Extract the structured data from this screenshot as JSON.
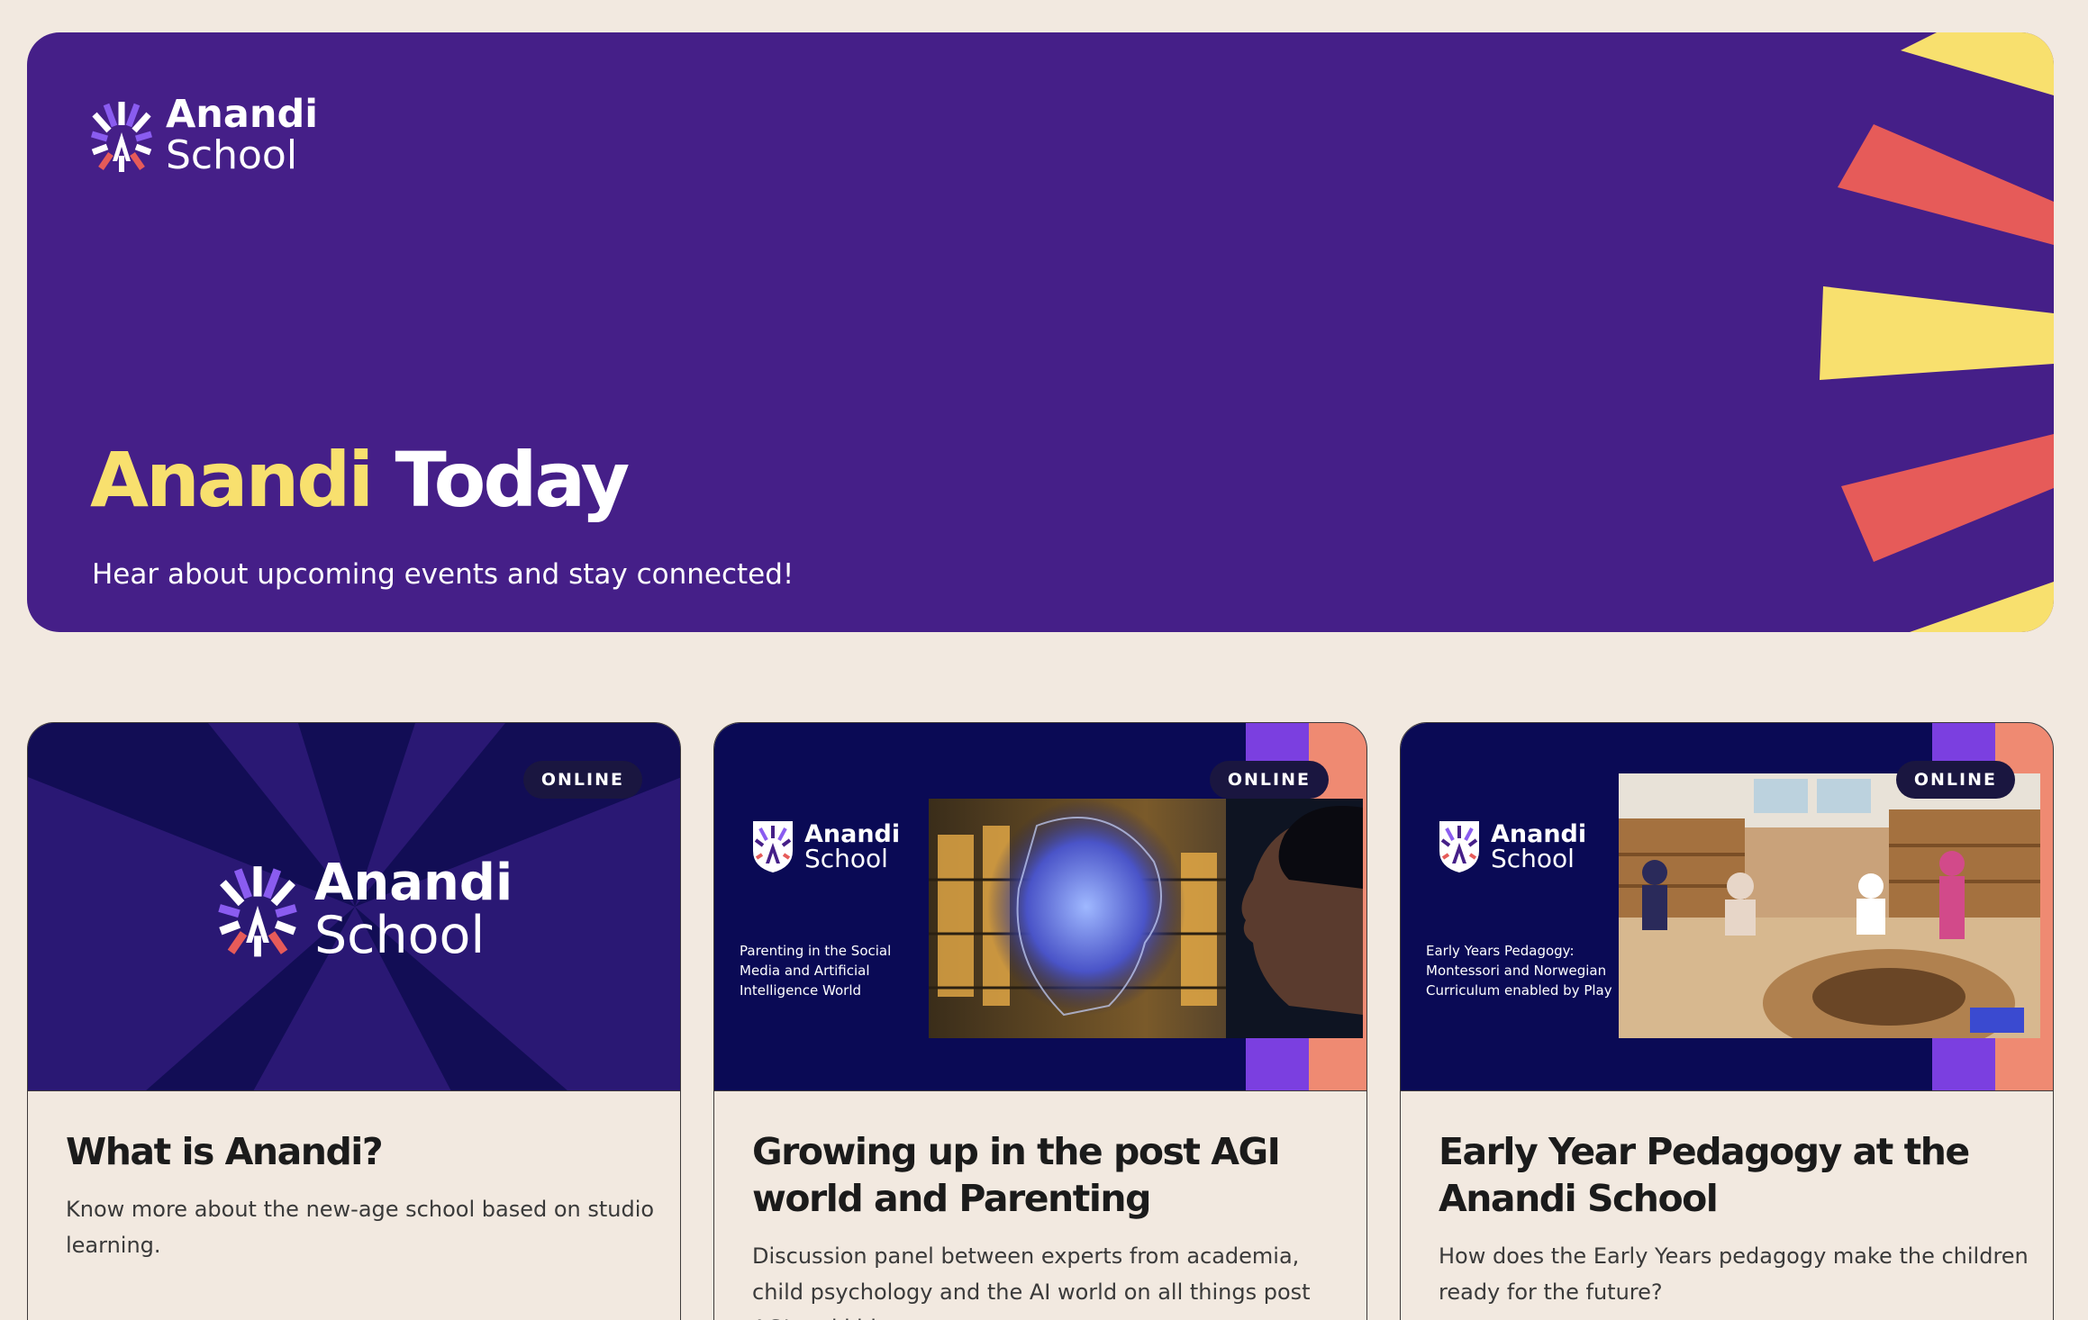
{
  "hero": {
    "logo_line1": "Anandi",
    "logo_line2": "School",
    "title_accent": "Anandi",
    "title_rest": " Today",
    "subtitle": "Hear about upcoming events and stay connected!"
  },
  "colors": {
    "page_bg": "#f2e9e0",
    "hero_bg": "#451f88",
    "accent_yellow": "#f8e06e",
    "accent_red": "#e65b59",
    "card_media_bg": "#0a0a55",
    "stripe_purple": "#7b3fe0",
    "stripe_peach": "#ef8a72"
  },
  "cards": [
    {
      "badge": "ONLINE",
      "logo_line1": "Anandi",
      "logo_line2": "School",
      "title": "What is Anandi?",
      "description": "Know more about the new-age school based on studio learning."
    },
    {
      "badge": "ONLINE",
      "logo_line1": "Anandi",
      "logo_line2": "School",
      "slide_caption": "Parenting in the Social Media and Artificial Intelligence World",
      "title": "Growing up in the post AGI world and Parenting",
      "description": "Discussion panel between experts from academia, child psychology and the AI world on all things post AGI and kids"
    },
    {
      "badge": "ONLINE",
      "logo_line1": "Anandi",
      "logo_line2": "School",
      "slide_caption": "Early Years Pedagogy: Montessori and Norwegian Curriculum enabled by Play",
      "title": "Early Year Pedagogy at the Anandi School",
      "description": "How does the Early Years pedagogy make the children ready for the future?"
    }
  ]
}
